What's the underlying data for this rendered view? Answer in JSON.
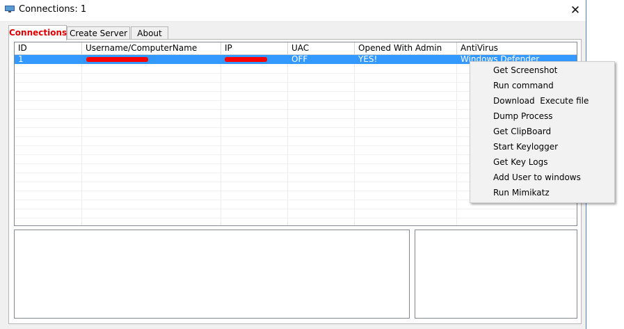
{
  "window": {
    "title": "Connections: 1",
    "close_glyph": "✕",
    "app_icon": "monitor-icon"
  },
  "tabs": [
    {
      "label": "Connections",
      "active": true
    },
    {
      "label": "Create Server",
      "active": false
    },
    {
      "label": "About",
      "active": false
    }
  ],
  "list": {
    "columns": [
      "ID",
      "Username/ComputerName",
      "IP",
      "UAC",
      "Opened With Admin",
      "AntiVirus"
    ],
    "rows": [
      {
        "id": "1",
        "username": "",
        "ip": "",
        "uac": "OFF",
        "admin": "YES!",
        "antivirus": "Windows Defender",
        "selected": true
      }
    ],
    "selection_color": "#3399ff",
    "redaction_color": "#ff0000"
  },
  "context_menu": {
    "items": [
      "Get Screenshot",
      "Run command",
      "Download  Execute file",
      "Dump Process",
      "Get ClipBoard",
      "Start Keylogger",
      "Get Key Logs",
      "Add User to windows",
      "Run Mimikatz"
    ]
  }
}
